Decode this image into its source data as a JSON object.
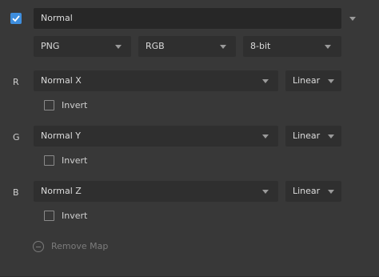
{
  "map": {
    "enabled": true,
    "name": "Normal",
    "format": "PNG",
    "color_mode": "RGB",
    "bit_depth": "8-bit"
  },
  "channels": [
    {
      "letter": "R",
      "source": "Normal X",
      "interpolation": "Linear",
      "invert_label": "Invert",
      "invert": false
    },
    {
      "letter": "G",
      "source": "Normal Y",
      "interpolation": "Linear",
      "invert_label": "Invert",
      "invert": false
    },
    {
      "letter": "B",
      "source": "Normal Z",
      "interpolation": "Linear",
      "invert_label": "Invert",
      "invert": false
    }
  ],
  "remove_label": "Remove Map",
  "icons": {
    "enable_checkbox": "checkmark-icon",
    "collapse": "chevron-down-icon",
    "remove": "minus-circle-icon"
  },
  "colors": {
    "accent": "#3e8ede",
    "panel": "#383838",
    "field": "#2f2f2f"
  }
}
